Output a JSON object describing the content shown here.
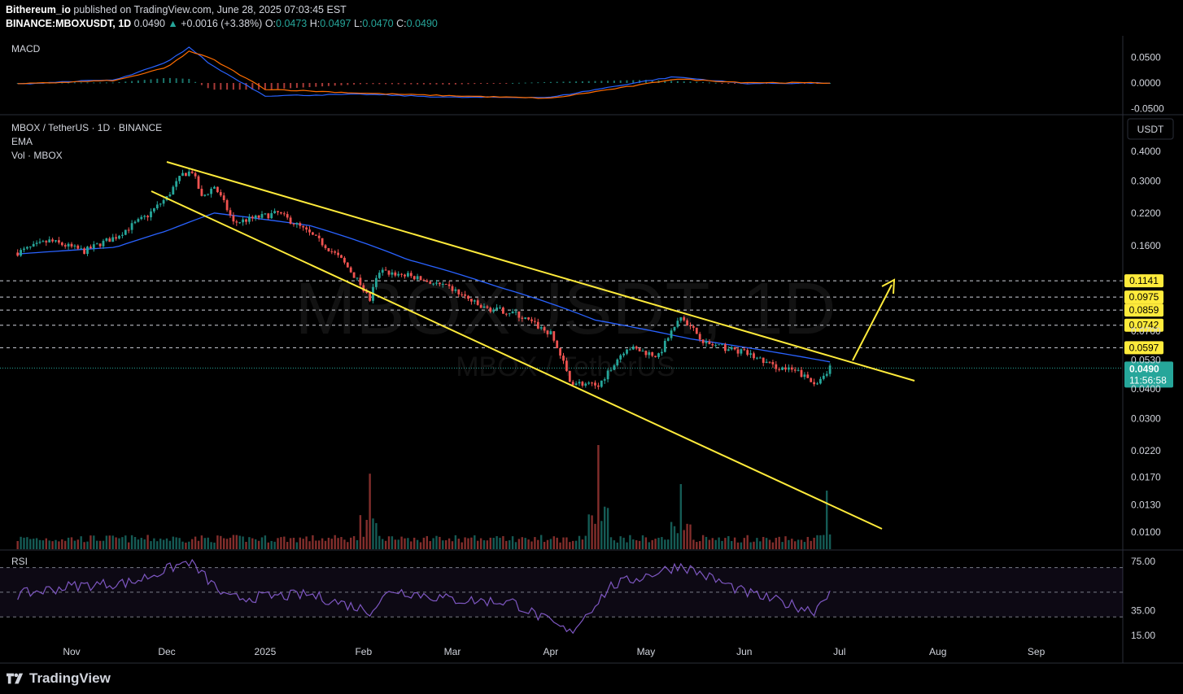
{
  "header": {
    "publisher": "Bithereum_io",
    "published_text": "published on TradingView.com, June 28, 2025 07:03:45 EST",
    "symbol": "BINANCE:MBOXUSDT, 1D",
    "price": "0.0490",
    "change": "+0.0016 (+3.38%)",
    "o_label": "O:",
    "o": "0.0473",
    "h_label": "H:",
    "h": "0.0497",
    "l_label": "L:",
    "l": "0.0470",
    "c_label": "C:",
    "c": "0.0490"
  },
  "panes": {
    "macd_label": "MACD",
    "main_title": "MBOX / TetherUS · 1D · BINANCE",
    "ema_label": "EMA",
    "vol_label": "Vol · MBOX",
    "rsi_label": "RSI",
    "watermark": "MBOXUSDT, 1D",
    "watermark_sub": "MBOX / TetherUS",
    "currency_button": "USDT"
  },
  "footer": {
    "brand": "TradingView"
  },
  "colors": {
    "up": "#26a69a",
    "down": "#ef5350",
    "ema": "#2962ff",
    "trend": "#ffeb3b",
    "macd": "#2962ff",
    "signal": "#ff6d00",
    "rsi": "#7e57c2",
    "bg": "#000000"
  },
  "chart_data": [
    {
      "type": "line",
      "title": "MACD",
      "y_ticks": [
        "0.0500",
        "0.0000",
        "-0.0500"
      ],
      "series": [
        {
          "name": "MACD",
          "x": [
            "Oct 15",
            "Nov 1",
            "Nov 15",
            "Dec 1",
            "Dec 8",
            "Dec 15",
            "Jan 1",
            "Feb 1",
            "Mar 1",
            "Apr 1",
            "May 1",
            "May 10",
            "Jun 1",
            "Jun 27"
          ],
          "values": [
            -0.002,
            0.003,
            0.006,
            0.04,
            0.07,
            0.035,
            -0.025,
            -0.022,
            -0.028,
            -0.028,
            0.004,
            0.012,
            -0.001,
            0.0
          ]
        },
        {
          "name": "Signal",
          "x": [
            "Oct 15",
            "Nov 1",
            "Nov 15",
            "Dec 1",
            "Dec 8",
            "Dec 15",
            "Jan 1",
            "Feb 1",
            "Mar 1",
            "Apr 1",
            "May 1",
            "May 10",
            "Jun 1",
            "Jun 27"
          ],
          "values": [
            -0.002,
            0.002,
            0.005,
            0.03,
            0.062,
            0.048,
            -0.012,
            -0.02,
            -0.025,
            -0.03,
            -0.002,
            0.008,
            0.001,
            0.0
          ]
        }
      ]
    },
    {
      "type": "candlestick",
      "title": "MBOX / TetherUS · 1D · BINANCE",
      "scale": "log",
      "ylim": [
        0.0085,
        0.44
      ],
      "y_ticks": [
        "0.4000",
        "0.3000",
        "0.2200",
        "0.1600",
        "0.0700",
        "0.0530",
        "0.0400",
        "0.0300",
        "0.0220",
        "0.0170",
        "0.0130",
        "0.0100"
      ],
      "x_ticks": [
        "Nov",
        "Dec",
        "2025",
        "Feb",
        "Mar",
        "Apr",
        "May",
        "Jun",
        "Jul",
        "Aug",
        "Sep"
      ],
      "close_path": [
        {
          "date": "2024-10-15",
          "close": 0.15
        },
        {
          "date": "2024-10-25",
          "close": 0.168
        },
        {
          "date": "2024-11-05",
          "close": 0.152
        },
        {
          "date": "2024-11-15",
          "close": 0.175
        },
        {
          "date": "2024-11-25",
          "close": 0.215
        },
        {
          "date": "2024-12-01",
          "close": 0.255
        },
        {
          "date": "2024-12-06",
          "close": 0.32
        },
        {
          "date": "2024-12-09",
          "close": 0.33
        },
        {
          "date": "2024-12-12",
          "close": 0.255
        },
        {
          "date": "2024-12-16",
          "close": 0.285
        },
        {
          "date": "2024-12-22",
          "close": 0.2
        },
        {
          "date": "2025-01-05",
          "close": 0.22
        },
        {
          "date": "2025-01-15",
          "close": 0.18
        },
        {
          "date": "2025-01-25",
          "close": 0.14
        },
        {
          "date": "2025-02-03",
          "close": 0.095
        },
        {
          "date": "2025-02-06",
          "close": 0.125
        },
        {
          "date": "2025-02-15",
          "close": 0.12
        },
        {
          "date": "2025-03-01",
          "close": 0.105
        },
        {
          "date": "2025-03-10",
          "close": 0.088
        },
        {
          "date": "2025-03-20",
          "close": 0.084
        },
        {
          "date": "2025-04-01",
          "close": 0.068
        },
        {
          "date": "2025-04-07",
          "close": 0.043
        },
        {
          "date": "2025-04-16",
          "close": 0.041
        },
        {
          "date": "2025-04-25",
          "close": 0.06
        },
        {
          "date": "2025-05-05",
          "close": 0.055
        },
        {
          "date": "2025-05-12",
          "close": 0.08
        },
        {
          "date": "2025-05-20",
          "close": 0.062
        },
        {
          "date": "2025-06-01",
          "close": 0.057
        },
        {
          "date": "2025-06-10",
          "close": 0.05
        },
        {
          "date": "2025-06-18",
          "close": 0.047
        },
        {
          "date": "2025-06-23",
          "close": 0.042
        },
        {
          "date": "2025-06-28",
          "close": 0.049
        }
      ],
      "ema_path": [
        {
          "date": "2024-10-15",
          "value": 0.148
        },
        {
          "date": "2024-11-15",
          "value": 0.158
        },
        {
          "date": "2024-12-01",
          "value": 0.185
        },
        {
          "date": "2024-12-16",
          "value": 0.22
        },
        {
          "date": "2025-01-15",
          "value": 0.195
        },
        {
          "date": "2025-02-15",
          "value": 0.14
        },
        {
          "date": "2025-03-15",
          "value": 0.108
        },
        {
          "date": "2025-04-15",
          "value": 0.078
        },
        {
          "date": "2025-05-15",
          "value": 0.065
        },
        {
          "date": "2025-06-28",
          "value": 0.052
        }
      ],
      "horizontal_levels": [
        "0.1141",
        "0.0975",
        "0.0859",
        "0.0742",
        "0.0597"
      ],
      "last_price_label": "0.0490",
      "countdown": "11:56:58"
    },
    {
      "type": "bar",
      "title": "Vol · MBOX",
      "notable_spikes": [
        {
          "date": "2025-02-03",
          "relative": 0.58
        },
        {
          "date": "2025-04-16",
          "relative": 0.8
        },
        {
          "date": "2025-05-12",
          "relative": 0.5
        },
        {
          "date": "2025-06-27",
          "relative": 0.45
        }
      ]
    },
    {
      "type": "line",
      "title": "RSI",
      "y_ticks": [
        "75.00",
        "35.00",
        "15.00"
      ],
      "bands": [
        70,
        30
      ],
      "series": [
        {
          "name": "RSI",
          "x": [
            "Oct 15",
            "Nov 1",
            "Nov 20",
            "Dec 8",
            "Dec 20",
            "Jan 15",
            "Feb 3",
            "Feb 10",
            "Mar 1",
            "Mar 20",
            "Apr 7",
            "Apr 20",
            "May 12",
            "Jun 1",
            "Jun 23",
            "Jun 28"
          ],
          "values": [
            48,
            55,
            58,
            75,
            45,
            48,
            35,
            52,
            44,
            42,
            17,
            55,
            72,
            50,
            35,
            52
          ]
        }
      ]
    }
  ]
}
